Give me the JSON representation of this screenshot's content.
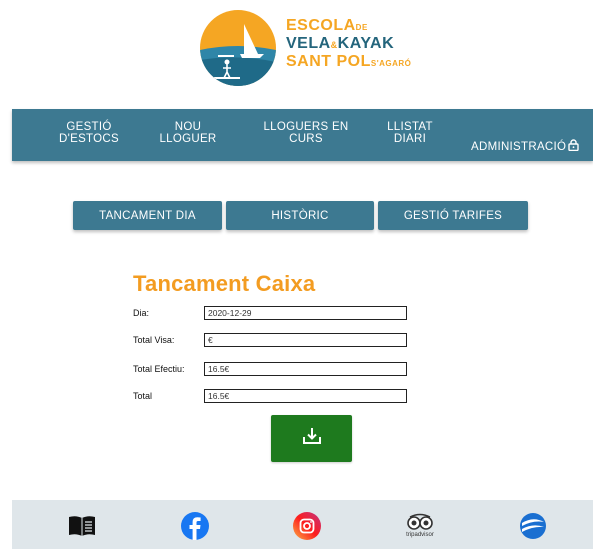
{
  "logo": {
    "line1": "ESCOLA",
    "line1_small": "DE",
    "line2_a": "VELA",
    "line2_amp": "&",
    "line2_b": "KAYAK",
    "line3": "SANT POL",
    "line3_small": "S'AGARÓ"
  },
  "nav": {
    "items": [
      {
        "label": "GESTIÓ\nD'ESTOCS"
      },
      {
        "label": "NOU\nLLOGUER"
      },
      {
        "label": "LLOGUERS EN\nCURS"
      },
      {
        "label": "LLISTAT\nDIARI"
      },
      {
        "label": "ADMINISTRACIÓ"
      }
    ]
  },
  "subnav": {
    "items": [
      {
        "label": "TANCAMENT DIA"
      },
      {
        "label": "HISTÒRIC"
      },
      {
        "label": "GESTIÓ TARIFES"
      }
    ]
  },
  "form": {
    "title": "Tancament Caixa",
    "fields": [
      {
        "label": "Dia:",
        "value": "2020-12-29"
      },
      {
        "label": "Total Visa:",
        "value": "€"
      },
      {
        "label": "Total Efectiu:",
        "value": "16.5€"
      },
      {
        "label": "Total",
        "value": "16.5€"
      }
    ]
  },
  "footer": {
    "icons": [
      "book-icon",
      "facebook-icon",
      "instagram-icon",
      "tripadvisor-icon",
      "brand-icon"
    ],
    "tripadvisor_text": "tripadvisor"
  },
  "colors": {
    "nav_bg": "#3d7991",
    "title_orange": "#f39c21",
    "download_green": "#1e7a1e",
    "footer_bg": "#dfe6ea"
  }
}
